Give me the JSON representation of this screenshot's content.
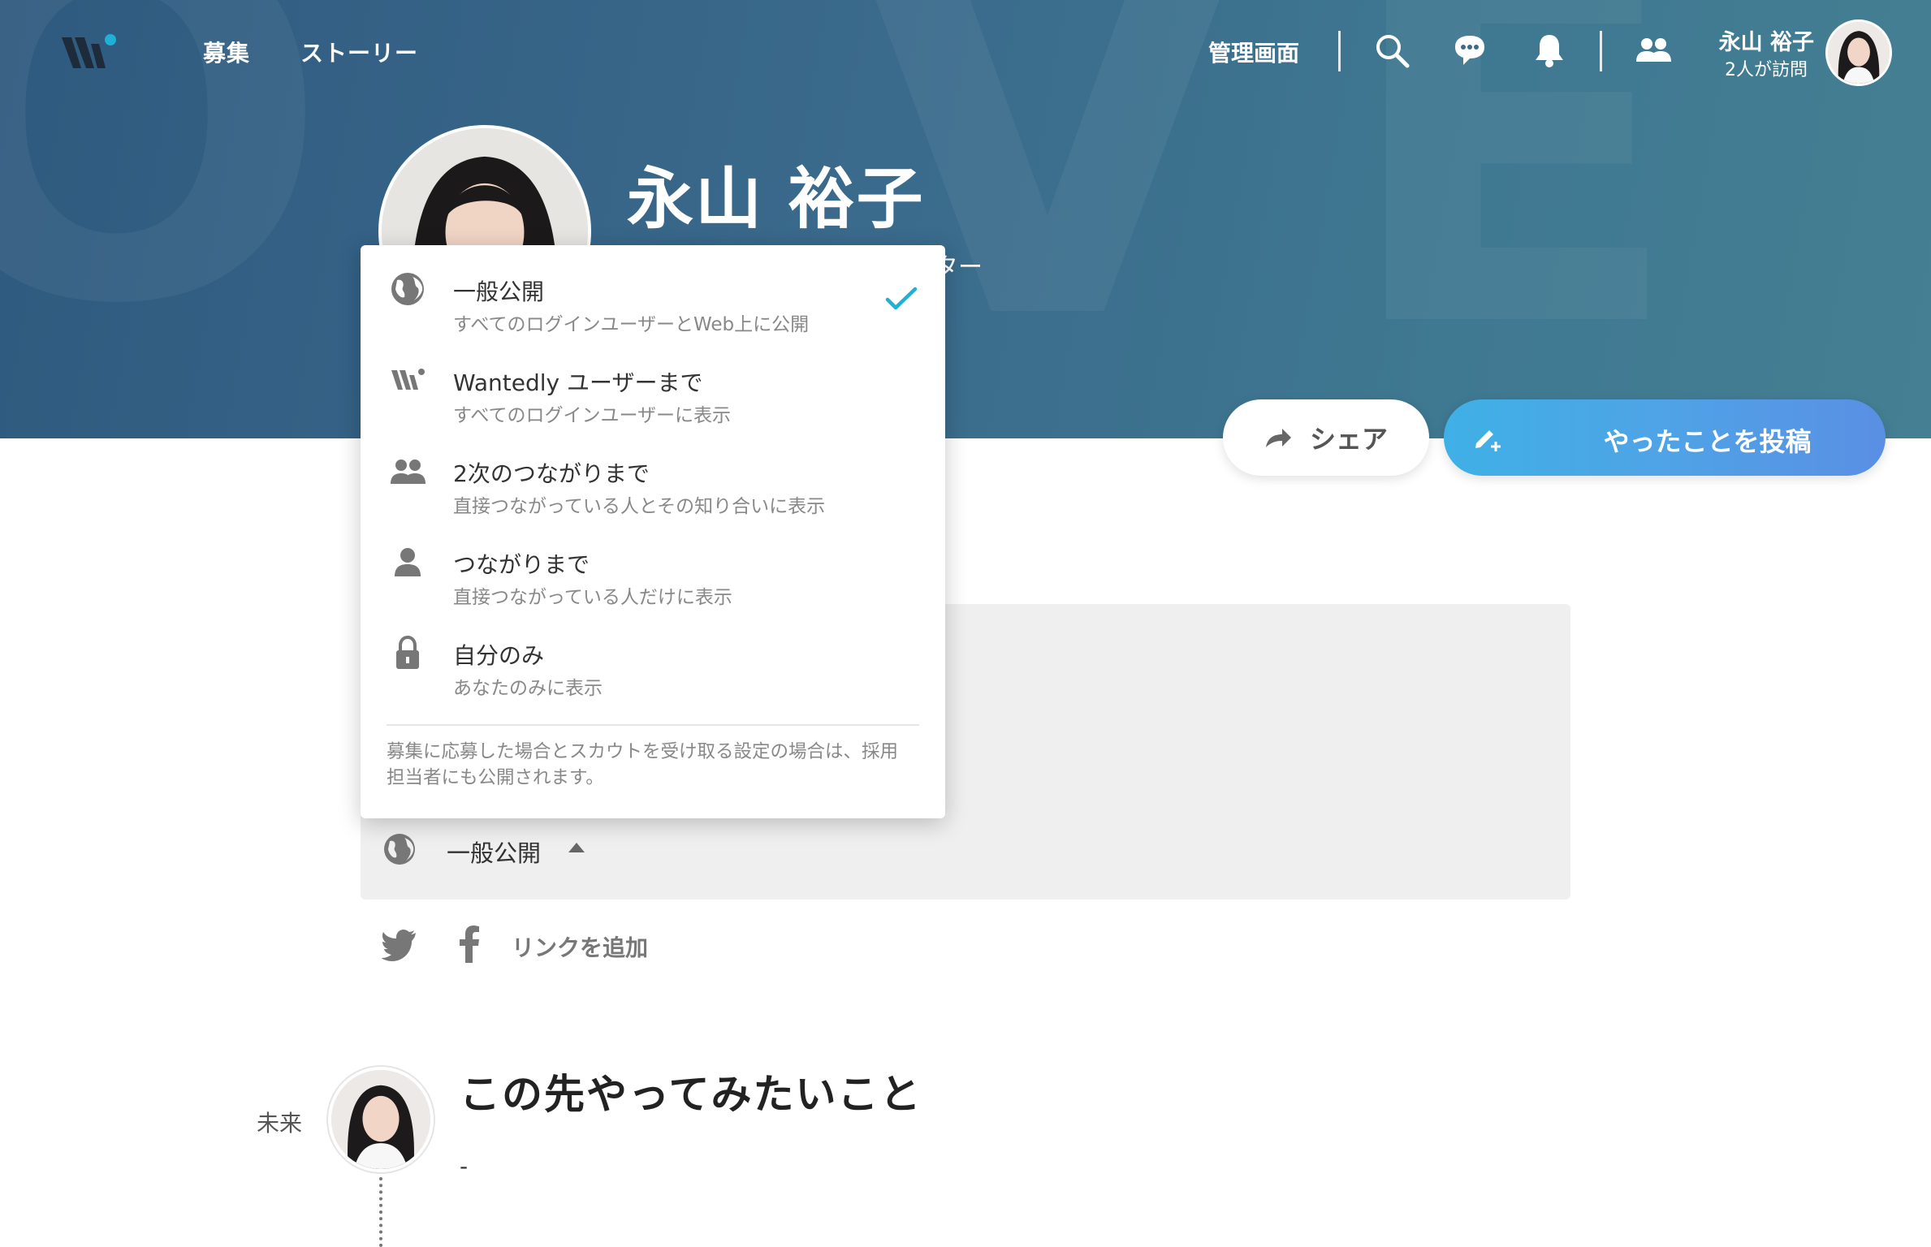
{
  "nav": {
    "links": [
      "募集",
      "ストーリー"
    ],
    "admin_label": "管理画面",
    "user_name": "永山 裕子",
    "visitor_text": "2人が訪問"
  },
  "profile": {
    "name": "永山 裕子",
    "role_fragment": "ター"
  },
  "actions": {
    "share_label": "シェア",
    "post_label": "やったことを投稿"
  },
  "privacy_menu": {
    "options": [
      {
        "title": "一般公開",
        "desc": "すべてのログインユーザーとWeb上に公開",
        "icon": "globe-icon",
        "selected": true
      },
      {
        "title": "Wantedly ユーザーまで",
        "desc": "すべてのログインユーザーに表示",
        "icon": "wantedly-icon",
        "selected": false
      },
      {
        "title": "2次のつながりまで",
        "desc": "直接つながっている人とその知り合いに表示",
        "icon": "group-icon",
        "selected": false
      },
      {
        "title": "つながりまで",
        "desc": "直接つながっている人だけに表示",
        "icon": "person-icon",
        "selected": false
      },
      {
        "title": "自分のみ",
        "desc": "あなたのみに表示",
        "icon": "lock-icon",
        "selected": false
      }
    ],
    "note": "募集に応募した場合とスカウトを受け取る設定の場合は、採用担当者にも公開されます。"
  },
  "privacy_toggle": {
    "label": "一般公開"
  },
  "social": {
    "add_link_label": "リンクを追加"
  },
  "future": {
    "label": "未来",
    "title": "この先やってみたいこと",
    "body": "-"
  },
  "colors": {
    "hero": "#3a6a8c",
    "accent": "#1fb0d6",
    "post_gradient_start": "#3fb0e6",
    "post_gradient_end": "#5a8fe4"
  }
}
